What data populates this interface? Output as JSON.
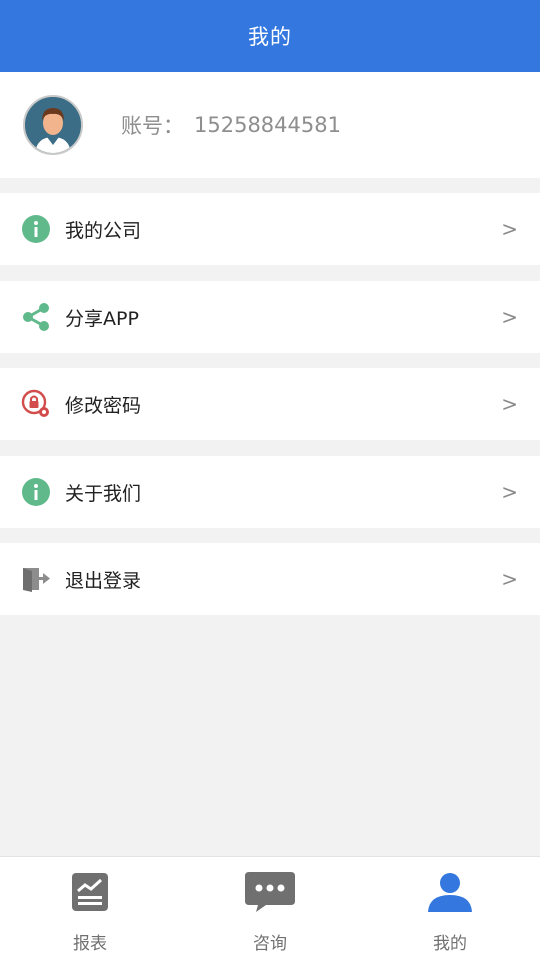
{
  "header": {
    "title": "我的"
  },
  "profile": {
    "account_label": "账号：",
    "account_value": "15258844581"
  },
  "menu": [
    {
      "label": "我的公司",
      "icon": "info-icon",
      "chevron": ">"
    },
    {
      "label": "分享APP",
      "icon": "share-icon",
      "chevron": ">"
    },
    {
      "label": "修改密码",
      "icon": "lock-settings-icon",
      "chevron": ">"
    },
    {
      "label": "关于我们",
      "icon": "info-icon",
      "chevron": ">"
    },
    {
      "label": "退出登录",
      "icon": "logout-icon",
      "chevron": ">"
    }
  ],
  "tabs": [
    {
      "label": "报表",
      "icon": "report-icon"
    },
    {
      "label": "咨询",
      "icon": "chat-icon"
    },
    {
      "label": "我的",
      "icon": "user-icon",
      "active": true
    }
  ],
  "colors": {
    "primary": "#3477de",
    "green": "#5fb98a",
    "red": "#d24c4c",
    "gray": "#707070"
  }
}
